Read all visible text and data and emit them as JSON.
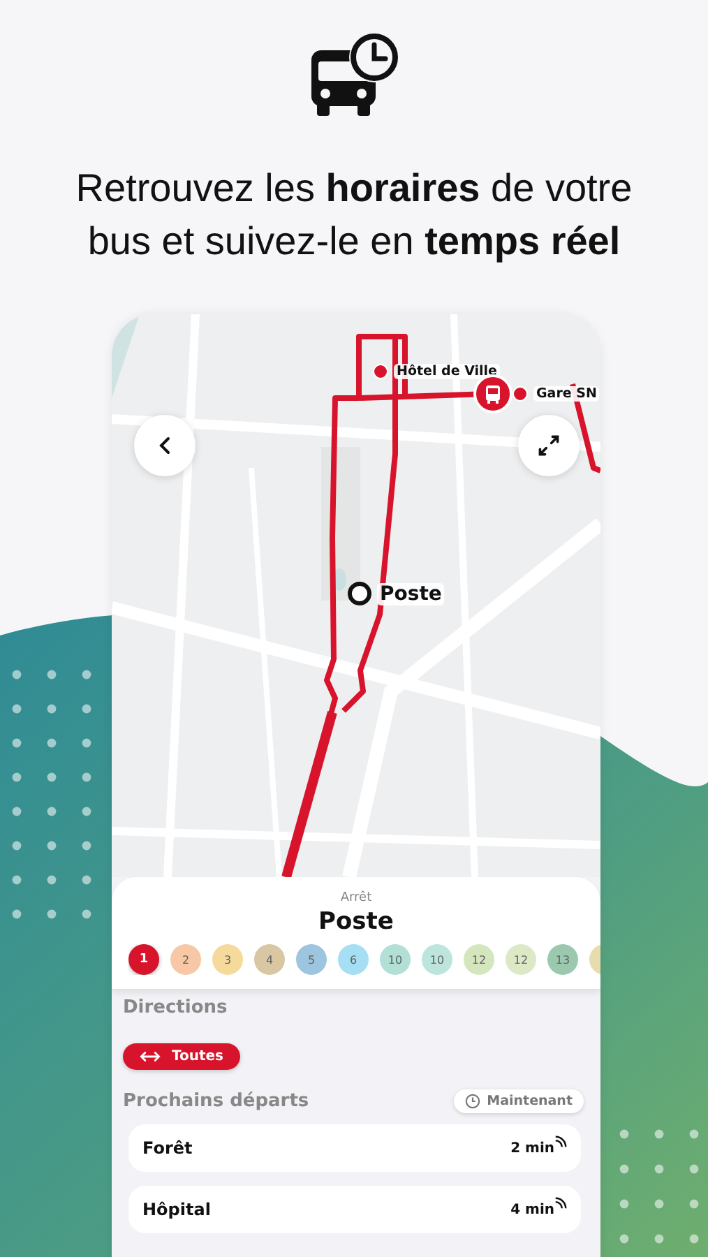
{
  "headline_lines": [
    "Retrouvez les **horaires** de votre",
    "bus et suivez-le en **temps réel**"
  ],
  "map": {
    "markers": [
      {
        "kind": "stop",
        "label": "Hôtel de Ville"
      },
      {
        "kind": "stop",
        "label": "Gare SN"
      },
      {
        "kind": "current",
        "label": "Poste"
      }
    ]
  },
  "stop": {
    "label": "Arrêt",
    "name": "Poste"
  },
  "lines": [
    {
      "label": "1",
      "color": "#d7142b",
      "selected": true
    },
    {
      "label": "2",
      "color": "#f7c7a6",
      "selected": false
    },
    {
      "label": "3",
      "color": "#f6da9c",
      "selected": false
    },
    {
      "label": "4",
      "color": "#d9c7a3",
      "selected": false
    },
    {
      "label": "5",
      "color": "#9dc5df",
      "selected": false
    },
    {
      "label": "6",
      "color": "#a6def3",
      "selected": false
    },
    {
      "label": "10",
      "color": "#b2e0d6",
      "selected": false
    },
    {
      "label": "10",
      "color": "#bde5dd",
      "selected": false
    },
    {
      "label": "12",
      "color": "#d4e6bd",
      "selected": false
    },
    {
      "label": "12",
      "color": "#dde9c6",
      "selected": false
    },
    {
      "label": "13",
      "color": "#9bc9b0",
      "selected": false
    },
    {
      "color": "#e6dcae",
      "selected": false
    }
  ],
  "directions": {
    "title": "Directions",
    "chips": [
      {
        "label": "Toutes",
        "selected": true
      }
    ]
  },
  "departures": {
    "title": "Prochains départs",
    "time_button": "Maintenant",
    "rows": [
      {
        "destination": "Forêt",
        "eta": "2 min",
        "realtime": true
      },
      {
        "destination": "Hôpital",
        "eta": "4 min",
        "realtime": true
      }
    ]
  }
}
